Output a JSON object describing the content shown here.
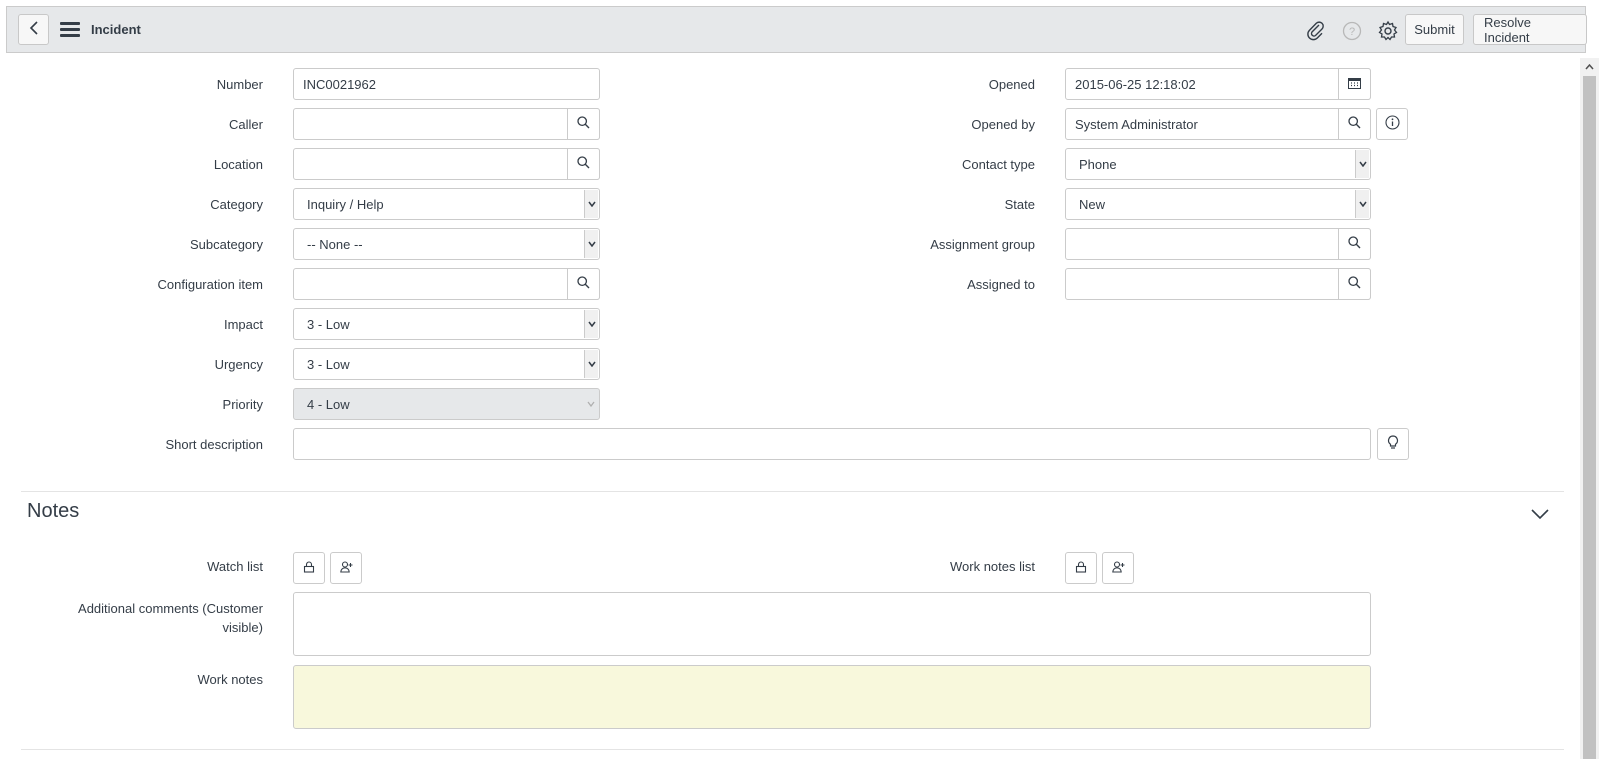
{
  "header": {
    "title": "Incident",
    "submit_label": "Submit",
    "resolve_label": "Resolve Incident",
    "icons": [
      "back-icon",
      "hamburger-icon",
      "paperclip-icon",
      "help-icon",
      "gear-icon"
    ]
  },
  "form": {
    "number": {
      "label": "Number",
      "value": "INC0021962"
    },
    "caller": {
      "label": "Caller",
      "value": ""
    },
    "location": {
      "label": "Location",
      "value": ""
    },
    "category": {
      "label": "Category",
      "value": "Inquiry / Help"
    },
    "subcategory": {
      "label": "Subcategory",
      "value": "-- None --"
    },
    "config_item": {
      "label": "Configuration item",
      "value": ""
    },
    "impact": {
      "label": "Impact",
      "value": "3 - Low"
    },
    "urgency": {
      "label": "Urgency",
      "value": "3 - Low"
    },
    "priority": {
      "label": "Priority",
      "value": "4 - Low"
    },
    "opened": {
      "label": "Opened",
      "value": "2015-06-25 12:18:02"
    },
    "opened_by": {
      "label": "Opened by",
      "value": "System Administrator"
    },
    "contact_type": {
      "label": "Contact type",
      "value": "Phone"
    },
    "state": {
      "label": "State",
      "value": "New"
    },
    "assignment_group": {
      "label": "Assignment group",
      "value": ""
    },
    "assigned_to": {
      "label": "Assigned to",
      "value": ""
    },
    "short_description": {
      "label": "Short description",
      "value": ""
    }
  },
  "notes": {
    "title": "Notes",
    "watch_list_label": "Watch list",
    "work_notes_list_label": "Work notes list",
    "additional_comments_label_1": "Additional comments (Customer",
    "additional_comments_label_2": "visible)",
    "work_notes_label": "Work notes"
  },
  "colors": {
    "header_bg": "#e6e8ea",
    "work_notes_bg": "#f8f8dc",
    "readonly_bg": "#e6e8ea",
    "border": "#cbcbcb"
  }
}
